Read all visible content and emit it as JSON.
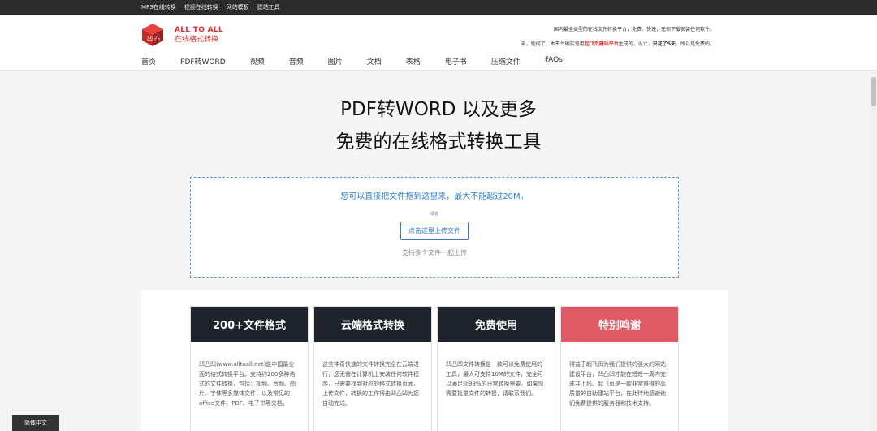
{
  "topbar": {
    "links": [
      "MP3在线转换",
      "视频在线转换",
      "网站模板",
      "建站工具"
    ]
  },
  "logo": {
    "en": "ALL TO ALL",
    "cn": "在线格式转换"
  },
  "header": {
    "line1": "国内最全类型的在线文件转换平台，免费、快速，无须下载安装任何软件。",
    "line2_pre": "亲，别问了，本平台确实是用",
    "line2_link": "起飞页建站平台",
    "line2_mid": "生成的，设计，",
    "line2_bold": "只花了5天",
    "line2_post": "。所以是免费的。"
  },
  "nav": {
    "items": [
      "首页",
      "PDF转WORD",
      "视频",
      "音频",
      "图片",
      "文档",
      "表格",
      "电子书",
      "压缩文件",
      "FAQs"
    ]
  },
  "hero": {
    "line1": "PDF转WORD 以及更多",
    "line2": "免费的在线格式转换工具"
  },
  "dropzone": {
    "main": "您可以直接把文件拖到这里来，最大不能超过20M。",
    "or": "或者",
    "button": "点击这里上传文件",
    "note": "支持多个文件一起上传"
  },
  "cards": [
    {
      "title": "200+文件格式",
      "color": "#1f232b",
      "body": "凹凸凹(www.alltoall.net)是中国最全面的格式转换平台。支持约200多种格式的文件转换，包括：视频、音频、图片、字体等多媒体文件，以及常见的office文件、PDF、电子书等文档。"
    },
    {
      "title": "云端格式转换",
      "color": "#1f232b",
      "body": "这些神奇快速的文件转换完全在云端进行，您无需在计算机上安装任何软件程序，只需要找到对应的格式转换页面，上传文件，转换的工作将由凹凸凹为您自动完成。"
    },
    {
      "title": "免费使用",
      "color": "#1f232b",
      "body": "凹凸凹文件转换是一款可以免费使用的工具，最大可支持10M的文件，完全可以满足您99%的日常转换需要。如果您需要批量文件的转换，请联系我们。"
    },
    {
      "title": "特别鸣谢",
      "color": "#e05a66",
      "body": "得益于起飞页为我们提供的强大的网站建设平台，凹凸凹才能在短短一周内完成并上线。起飞页是一款非常难得的高质量的自助建站平台，在此特地感谢他们免费提供的服务器和技术支持。"
    }
  ],
  "lang": "简体中文"
}
